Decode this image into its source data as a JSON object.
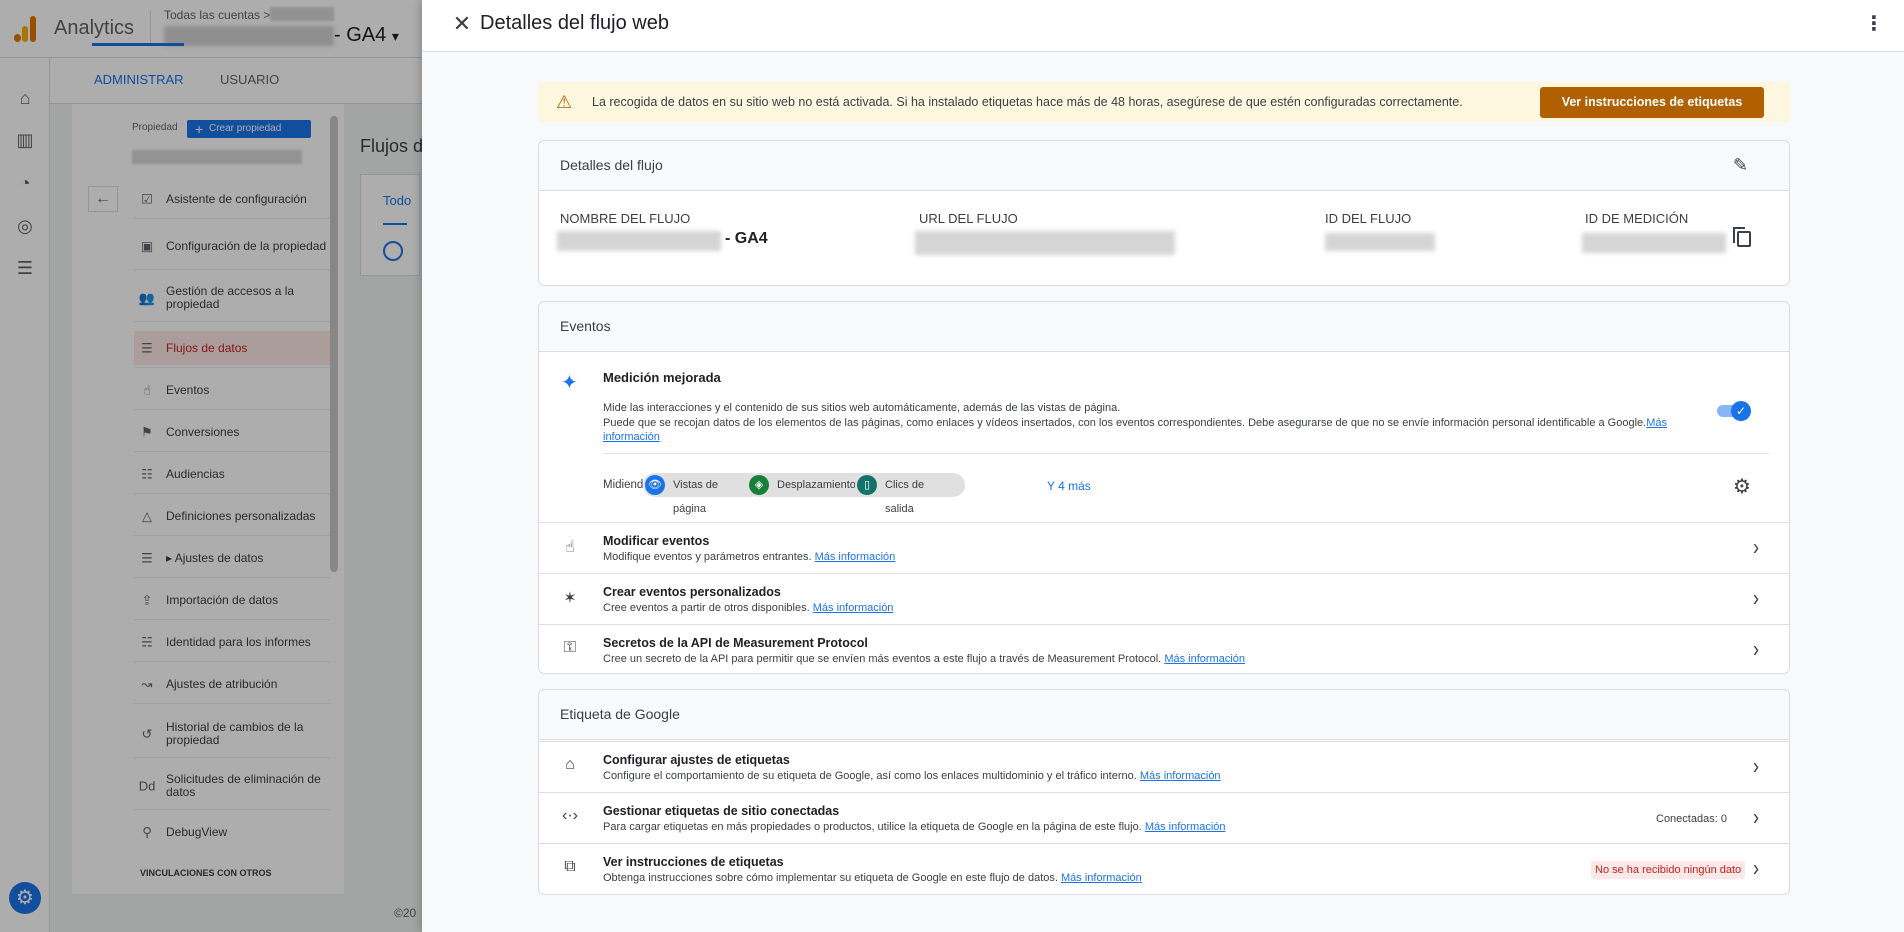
{
  "app": {
    "name": "Analytics",
    "account_breadcrumb": "Todas las cuentas",
    "property_suffix": "- GA4",
    "property_dropdown": "▾"
  },
  "admin_tabs": [
    {
      "label": "ADMINISTRAR",
      "active": true
    },
    {
      "label": "USUARIO",
      "active": false
    }
  ],
  "admin_panel": {
    "property_label": "Propiedad",
    "create_property": "Crear propiedad",
    "nav": [
      {
        "label": "Asistente de configuración",
        "icon": "checkbox-icon",
        "glyph": "☑"
      },
      {
        "label": "Configuración de la propiedad",
        "icon": "layout-icon",
        "glyph": "▣"
      },
      {
        "label": "Gestión de accesos a la propiedad",
        "icon": "group-icon",
        "glyph": "👥"
      },
      {
        "label": "Flujos de datos",
        "icon": "streams-icon",
        "glyph": "☰",
        "active": true
      },
      {
        "label": "Eventos",
        "icon": "touch-icon",
        "glyph": "☝"
      },
      {
        "label": "Conversiones",
        "icon": "flag-icon",
        "glyph": "⚑"
      },
      {
        "label": "Audiencias",
        "icon": "audience-icon",
        "glyph": "☷"
      },
      {
        "label": "Definiciones personalizadas",
        "icon": "shapes-icon",
        "glyph": "△"
      },
      {
        "label": "▸  Ajustes de datos",
        "icon": "database-icon",
        "glyph": "☰"
      },
      {
        "label": "Importación de datos",
        "icon": "upload-icon",
        "glyph": "⇪"
      },
      {
        "label": "Identidad para los informes",
        "icon": "identity-icon",
        "glyph": "☵"
      },
      {
        "label": "Ajustes de atribución",
        "icon": "attribution-icon",
        "glyph": "↝"
      },
      {
        "label": "Historial de cambios de la propiedad",
        "icon": "history-icon",
        "glyph": "↺"
      },
      {
        "label": "Solicitudes de eliminación de datos",
        "icon": "delete-data-icon",
        "glyph": "Dd"
      },
      {
        "label": "DebugView",
        "icon": "debug-icon",
        "glyph": "⚲"
      }
    ],
    "section_label": "VINCULACIONES CON OTROS"
  },
  "background": {
    "flows_title": "Flujos d",
    "flows_tab": "Todo",
    "footer": "©20"
  },
  "drawer": {
    "title": "Detalles del flujo web",
    "alert": {
      "text": "La recogida de datos en su sitio web no está activada. Si ha instalado etiquetas hace más de 48 horas, asegúrese de que estén configuradas correctamente.",
      "button": "Ver instrucciones de etiquetas"
    },
    "stream_details": {
      "title": "Detalles del flujo",
      "labels": {
        "name": "NOMBRE DEL FLUJO",
        "url": "URL DEL FLUJO",
        "id": "ID DEL FLUJO",
        "measurement_id": "ID DE MEDICIÓN"
      },
      "name_suffix": "- GA4"
    },
    "events": {
      "title": "Eventos",
      "enhanced": {
        "title": "Medición mejorada",
        "desc1": "Mide las interacciones y el contenido de sus sitios web automáticamente, además de las vistas de página.",
        "desc2": "Puede que se recojan datos de los elementos de las páginas, como enlaces y vídeos insertados, con los eventos correspondientes. Debe asegurarse de que no se envíe información personal identificable a Google.",
        "link": "Más información",
        "enabled": true,
        "measuring_label": "Midiendo:",
        "chips": [
          {
            "label": "Vistas de página",
            "icon": "eye-icon",
            "glyph": "👁",
            "color": "#1a73e8"
          },
          {
            "label": "Desplazamientos",
            "icon": "scroll-icon",
            "glyph": "◈",
            "color": "#188038"
          },
          {
            "label": "Clics de salida",
            "icon": "mouse-icon",
            "glyph": "▯",
            "color": "#12736b"
          }
        ],
        "more": "Y 4 más"
      },
      "rows": [
        {
          "title": "Modificar eventos",
          "desc": "Modifique eventos y parámetros entrantes.",
          "link": "Más información",
          "icon": "touch-icon",
          "glyph": "☝"
        },
        {
          "title": "Crear eventos personalizados",
          "desc": "Cree eventos a partir de otros disponibles.",
          "link": "Más información",
          "icon": "sparkle-click-icon",
          "glyph": "✶"
        },
        {
          "title": "Secretos de la API de Measurement Protocol",
          "desc": "Cree un secreto de la API para permitir que se envíen más eventos a este flujo a través de Measurement Protocol.",
          "link": "Más información",
          "icon": "key-icon",
          "glyph": "⚿"
        }
      ]
    },
    "google_tag": {
      "title": "Etiqueta de Google",
      "rows": [
        {
          "title": "Configurar ajustes de etiquetas",
          "desc": "Configure el comportamiento de su etiqueta de Google, así como los enlaces multidominio y el tráfico interno.",
          "link": "Más información",
          "icon": "tag-icon",
          "glyph": "⌂",
          "badge": ""
        },
        {
          "title": "Gestionar etiquetas de sitio conectadas",
          "desc": "Para cargar etiquetas en más propiedades o productos, utilice la etiqueta de Google en la página de este flujo.",
          "link": "Más información",
          "icon": "code-icon",
          "glyph": "‹·›",
          "badge": "Conectadas: 0"
        },
        {
          "title": "Ver instrucciones de etiquetas",
          "desc": "Obtenga instrucciones sobre cómo implementar su etiqueta de Google en este flujo de datos.",
          "link": "Más información",
          "icon": "code-box-icon",
          "glyph": "⧉",
          "badge": "No se ha recibido ningún dato"
        }
      ]
    }
  }
}
